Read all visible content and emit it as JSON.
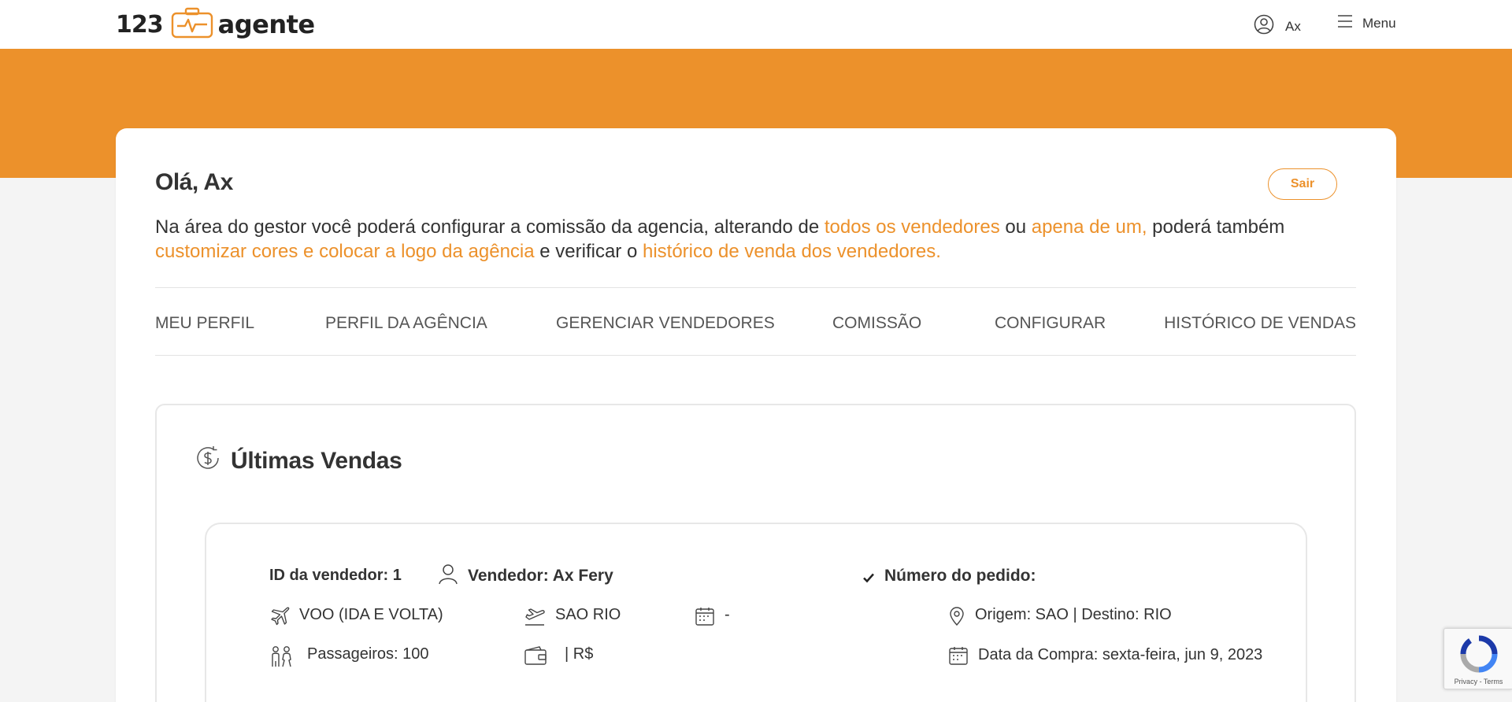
{
  "header": {
    "logo_number": "123",
    "logo_word": "agente",
    "user_name": "Ax",
    "menu_label": "Menu"
  },
  "colors": {
    "accent": "#ec912b",
    "text": "#333333",
    "border": "#e7e7e7",
    "background": "#f4f4f4"
  },
  "icons": {
    "logo": "suitcase-plane-icon",
    "user": "user-circle-icon",
    "menu": "hamburger-menu-icon",
    "sales": "dollar-refresh-icon",
    "seller": "user-outline-icon",
    "check": "check-icon",
    "flight": "airplane-icon",
    "departure": "plane-takeoff-icon",
    "date": "calendar-icon",
    "location": "map-pin-icon",
    "passengers": "people-icon",
    "wallet": "wallet-icon",
    "purchase_date": "calendar-icon"
  },
  "welcome": {
    "greeting": "Olá, Ax",
    "logout_label": "Sair",
    "intro": {
      "t1": "Na área do gestor você poderá configurar a comissão da agencia, alterando de ",
      "l1": "todos os vendedores",
      "t2": " ou ",
      "l2": "apena de um,",
      "t3": "  poderá também ",
      "l3": "customizar cores e colocar a logo da agência",
      "t4": " e verificar o ",
      "l4": "histórico de venda dos vendedores."
    }
  },
  "tabs": [
    {
      "label": "MEU PERFIL"
    },
    {
      "label": "PERFIL DA AGÊNCIA"
    },
    {
      "label": "GERENCIAR VENDEDORES"
    },
    {
      "label": "COMISSÃO"
    },
    {
      "label": "CONFIGURAR"
    },
    {
      "label": "HISTÓRICO DE VENDAS"
    }
  ],
  "sales": {
    "title": "Últimas Vendas",
    "items": [
      {
        "seller_id": "ID da vendedor: 1",
        "seller": "Vendedor: Ax Fery",
        "order_number": "Número do pedido:",
        "flight_type": "VOO (IDA E VOLTA)",
        "route": "SAO RIO",
        "date": "-",
        "origin_destination": "Origem: SAO | Destino: RIO",
        "passengers": "Passageiros: 100",
        "price": "| R$",
        "purchase_date": "Data da Compra:  sexta-feira, jun 9, 2023"
      }
    ]
  },
  "recaptcha": {
    "privacy": "Privacy",
    "separator": " - ",
    "terms": "Terms"
  }
}
